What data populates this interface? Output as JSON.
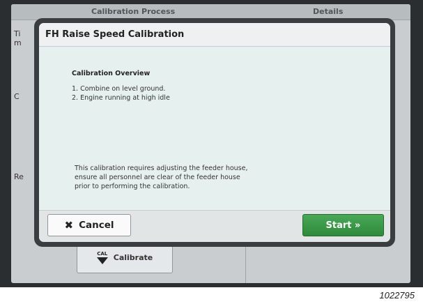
{
  "background": {
    "header_left": "Calibration Process",
    "header_right": "Details",
    "left_fragments": [
      "Ti",
      "m",
      "C",
      "Re"
    ],
    "calibrate_button": {
      "icon_text": "CAL",
      "label": "Calibrate"
    }
  },
  "modal": {
    "title": "FH Raise Speed Calibration",
    "overview_title": "Calibration Overview",
    "steps": [
      "1. Combine on level ground.",
      "2. Engine running at high idle"
    ],
    "warning_lines": [
      "This calibration requires adjusting the feeder house,",
      "ensure all personnel are clear of the feeder house",
      "prior to performing the calibration."
    ],
    "cancel_label": "Cancel",
    "start_label": "Start »"
  },
  "image_id": "1022795",
  "colors": {
    "start_green": "#3a9a48",
    "bezel": "#2b2e30",
    "modal_body": "#e6f0ee"
  }
}
